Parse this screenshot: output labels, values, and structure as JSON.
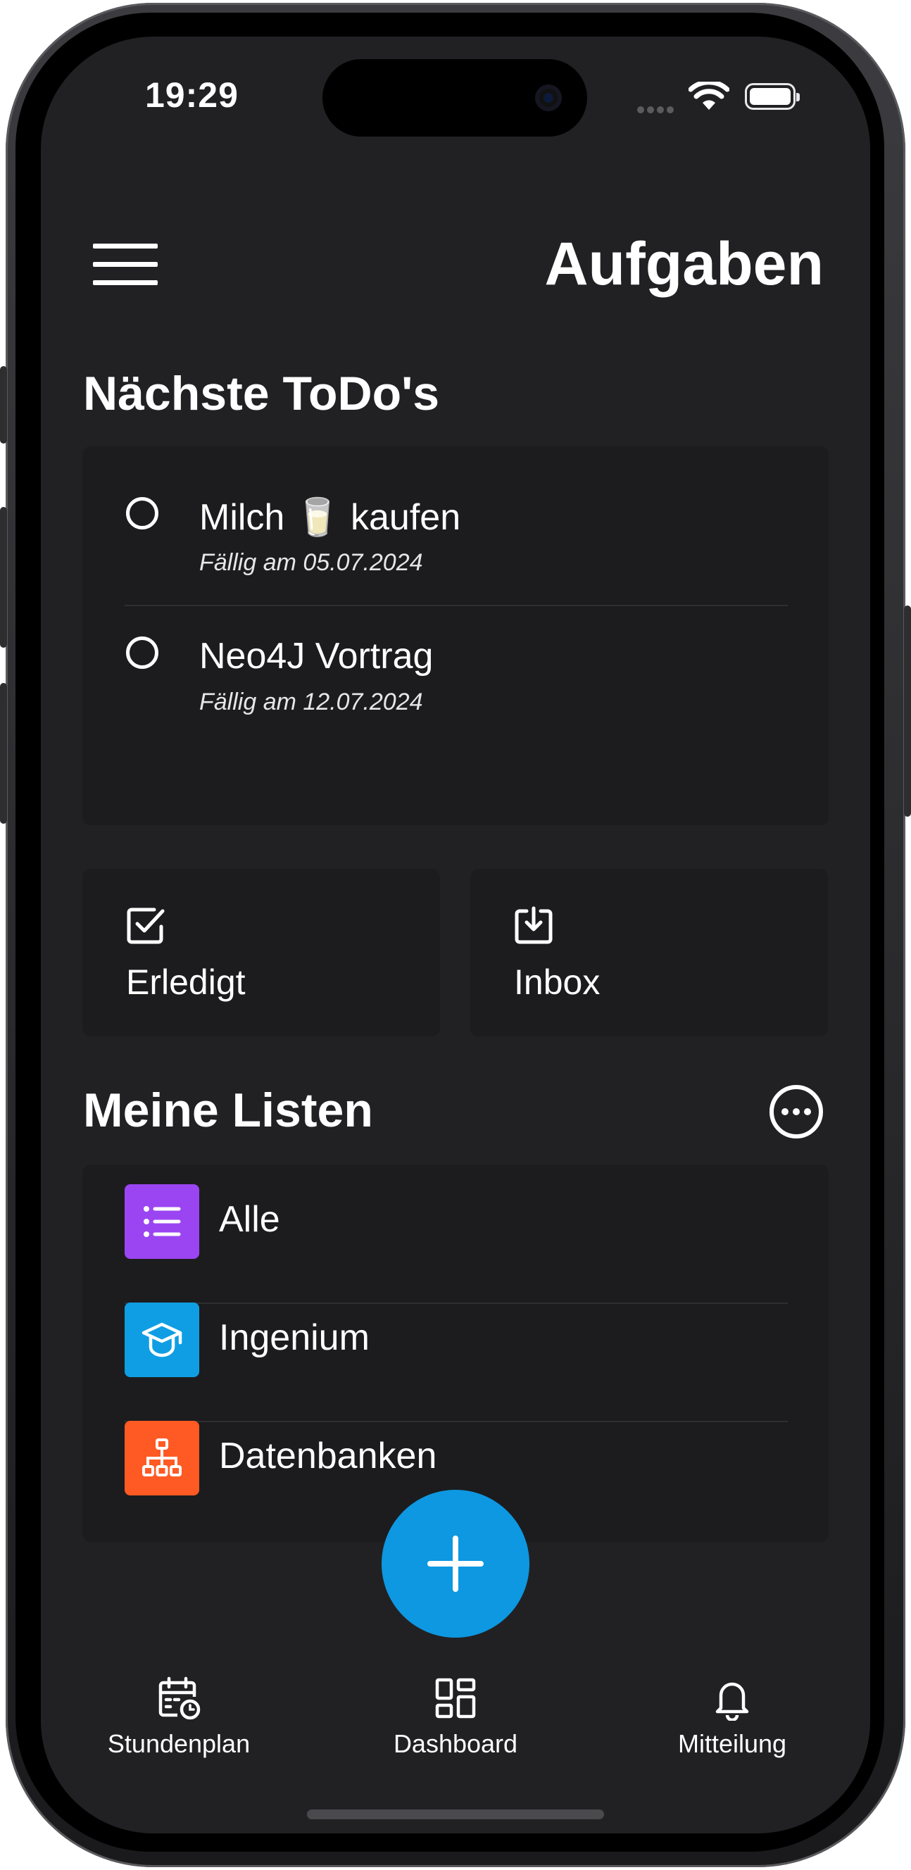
{
  "status_bar": {
    "time": "19:29"
  },
  "header": {
    "title": "Aufgaben",
    "menu_icon": "hamburger-menu-icon"
  },
  "next_todos": {
    "title": "Nächste ToDo's",
    "items": [
      {
        "title": "Milch 🥛 kaufen",
        "due": "Fällig am 05.07.2024"
      },
      {
        "title": "Neo4J Vortrag",
        "due": "Fällig am 12.07.2024"
      }
    ]
  },
  "tiles": [
    {
      "label": "Erledigt",
      "icon": "checkbox-icon"
    },
    {
      "label": "Inbox",
      "icon": "inbox-download-icon"
    }
  ],
  "my_lists": {
    "title": "Meine Listen",
    "more_icon": "more-horizontal-circle-icon",
    "items": [
      {
        "label": "Alle",
        "icon": "list-icon",
        "color": "#9b45f2"
      },
      {
        "label": "Ingenium",
        "icon": "graduation-cap-icon",
        "color": "#0f9ee3"
      },
      {
        "label": "Datenbanken",
        "icon": "hierarchy-icon",
        "color": "#ff5a24"
      }
    ]
  },
  "fab": {
    "icon": "plus-icon",
    "color": "#0d98e1"
  },
  "bottom_nav": [
    {
      "label": "Stundenplan",
      "icon": "calendar-clock-icon"
    },
    {
      "label": "Dashboard",
      "icon": "dashboard-grid-icon"
    },
    {
      "label": "Mitteilung",
      "icon": "bell-icon"
    }
  ],
  "colors": {
    "background": "#212124",
    "card": "#1c1c1e",
    "text": "#ffffff"
  }
}
